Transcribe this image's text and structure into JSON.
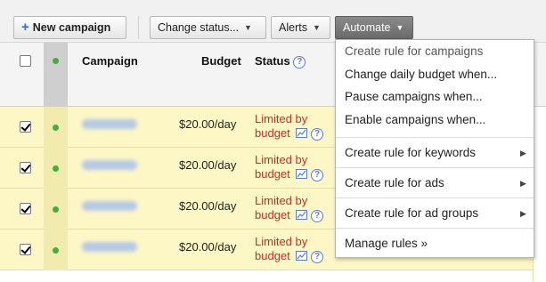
{
  "toolbar": {
    "new_campaign_icon": "+",
    "new_campaign": "New campaign",
    "change_status": "Change status...",
    "alerts": "Alerts",
    "automate": "Automate",
    "caret": "▼"
  },
  "table": {
    "headers": {
      "campaign": "Campaign",
      "budget": "Budget",
      "status": "Status",
      "help": "?"
    },
    "rows": [
      {
        "budget": "$20.00/day",
        "status_line1": "Limited by",
        "status_line2": "budget",
        "help": "?"
      },
      {
        "budget": "$20.00/day",
        "status_line1": "Limited by",
        "status_line2": "budget",
        "help": "?"
      },
      {
        "budget": "$20.00/day",
        "status_line1": "Limited by",
        "status_line2": "budget",
        "help": "?"
      },
      {
        "budget": "$20.00/day",
        "status_line1": "Limited by",
        "status_line2": "budget",
        "help": "?"
      }
    ]
  },
  "menu": {
    "items": [
      {
        "label": "Create rule for campaigns"
      },
      {
        "label": "Change daily budget when..."
      },
      {
        "label": "Pause campaigns when..."
      },
      {
        "label": "Enable campaigns when..."
      },
      {
        "label": "Create rule for keywords",
        "submenu_arrow": "▶"
      },
      {
        "label": "Create rule for ads",
        "submenu_arrow": "▶"
      },
      {
        "label": "Create rule for ad groups",
        "submenu_arrow": "▶"
      },
      {
        "label": "Manage rules »"
      }
    ]
  },
  "colors": {
    "row_highlight": "#fdf7c6",
    "status_limited": "#dd2222",
    "enabled_dot": "#3bb33b",
    "automate_active": "#777777"
  }
}
